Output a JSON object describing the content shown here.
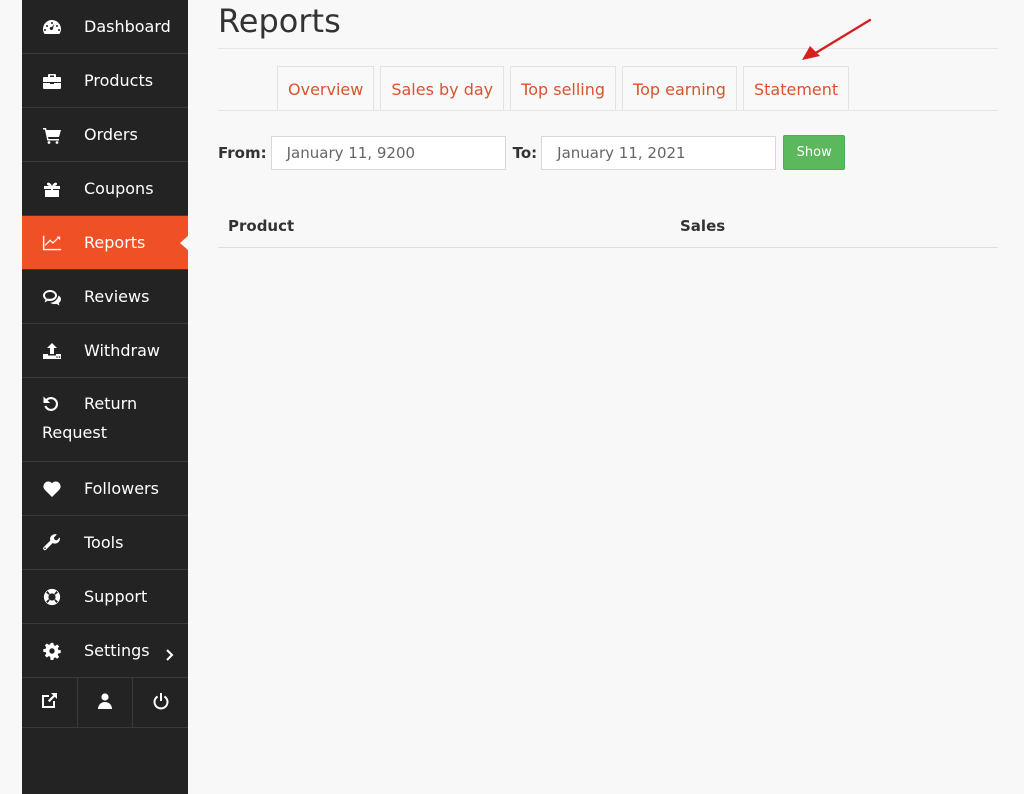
{
  "sidebar": {
    "items": [
      {
        "label": "Dashboard",
        "icon": "dashboard-icon"
      },
      {
        "label": "Products",
        "icon": "briefcase-icon"
      },
      {
        "label": "Orders",
        "icon": "cart-icon"
      },
      {
        "label": "Coupons",
        "icon": "gift-icon"
      },
      {
        "label": "Reports",
        "icon": "line-chart-icon",
        "active": true
      },
      {
        "label": "Reviews",
        "icon": "comments-icon"
      },
      {
        "label": "Withdraw",
        "icon": "upload-icon"
      },
      {
        "label_line1": "Return",
        "label_line2": "Request",
        "icon": "undo-icon"
      },
      {
        "label": "Followers",
        "icon": "heart-icon"
      },
      {
        "label": "Tools",
        "icon": "wrench-icon"
      },
      {
        "label": "Support",
        "icon": "lifebuoy-icon"
      },
      {
        "label": "Settings",
        "icon": "gear-icon"
      }
    ],
    "bottom": [
      "external-link-icon",
      "user-icon",
      "power-icon"
    ],
    "active_color": "#f05025"
  },
  "page": {
    "title": "Reports"
  },
  "tabs": [
    "Overview",
    "Sales by day",
    "Top selling",
    "Top earning",
    "Statement"
  ],
  "filter": {
    "from_label": "From:",
    "from_value": "January 11, 9200",
    "to_label": "To:",
    "to_value": "January 11, 2021",
    "show_label": "Show"
  },
  "table": {
    "columns": [
      "Product",
      "Sales"
    ]
  }
}
